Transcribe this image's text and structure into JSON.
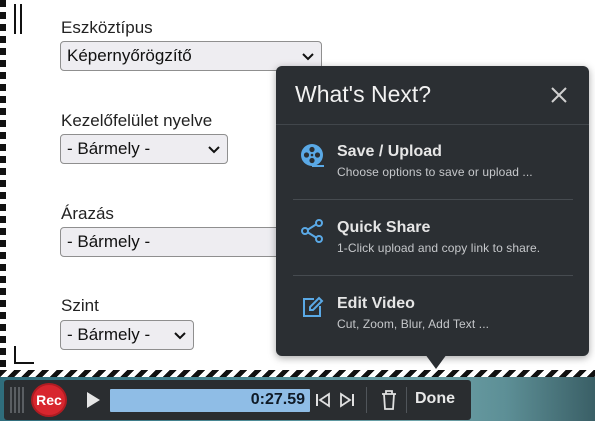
{
  "form": {
    "fields": [
      {
        "label": "Eszköztípus",
        "value": "Képernyőrögzítő"
      },
      {
        "label": "Kezelőfelület nyelve",
        "value": "- Bármely -"
      },
      {
        "label": "Árazás",
        "value": "- Bármely -"
      },
      {
        "label": "Szint",
        "value": "- Bármely -"
      }
    ]
  },
  "popup": {
    "title": "What's Next?",
    "close_icon": "close-icon",
    "items": [
      {
        "title": "Save / Upload",
        "subtitle": "Choose options to save or upload ...",
        "icon": "film-reel-icon"
      },
      {
        "title": "Quick Share",
        "subtitle": "1-Click upload and copy link to share.",
        "icon": "share-icon"
      },
      {
        "title": "Edit Video",
        "subtitle": "Cut, Zoom, Blur, Add Text ...",
        "icon": "edit-icon"
      }
    ],
    "accent_color": "#5aa9e6"
  },
  "recorder": {
    "rec_label": "Rec",
    "time": "0:27.59",
    "done_label": "Done",
    "rec_color": "#d8262e",
    "timeline_color": "#8fbde6"
  }
}
